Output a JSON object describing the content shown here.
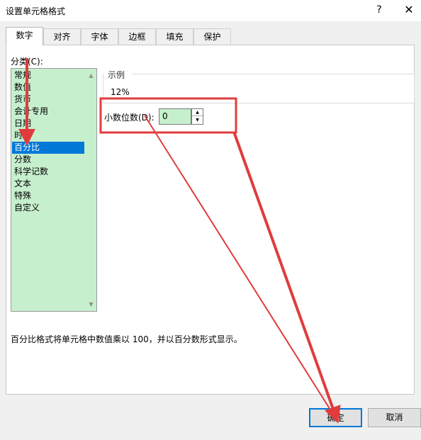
{
  "window": {
    "title": "设置单元格格式",
    "help": "?",
    "close": "✕"
  },
  "tabs": [
    {
      "label": "数字"
    },
    {
      "label": "对齐"
    },
    {
      "label": "字体"
    },
    {
      "label": "边框"
    },
    {
      "label": "填充"
    },
    {
      "label": "保护"
    }
  ],
  "category": {
    "label": "分类(C):",
    "items": [
      "常规",
      "数值",
      "货币",
      "会计专用",
      "日期",
      "时间",
      "百分比",
      "分数",
      "科学记数",
      "文本",
      "特殊",
      "自定义"
    ],
    "selected": "百分比"
  },
  "sample": {
    "label": "示例",
    "value": "12%"
  },
  "decimals": {
    "label": "小数位数(D):",
    "value": "0"
  },
  "description": "百分比格式将单元格中数值乘以 100，并以百分数形式显示。",
  "buttons": {
    "ok": "确定",
    "cancel": "取消"
  },
  "annotation_color": "#e03c3c"
}
